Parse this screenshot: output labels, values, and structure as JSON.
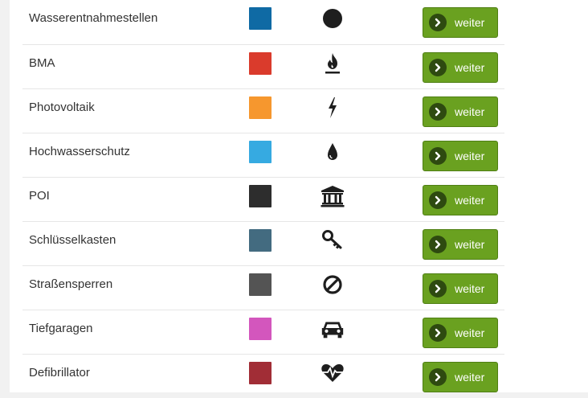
{
  "button_label": "weiter",
  "colors": {
    "button_bg": "#6aa120",
    "button_chevron_bg": "#2e4a10",
    "icon_color": "#1e1e1e"
  },
  "items": [
    {
      "label": "Wasserentnahmestellen",
      "color": "#0f6aa4",
      "icon": "circle-icon"
    },
    {
      "label": "BMA",
      "color": "#da3b2c",
      "icon": "fire-icon"
    },
    {
      "label": "Photovoltaik",
      "color": "#f6972e",
      "icon": "bolt-icon"
    },
    {
      "label": "Hochwasserschutz",
      "color": "#36aae1",
      "icon": "water-drop-icon"
    },
    {
      "label": "POI",
      "color": "#2d2d2d",
      "icon": "bank-icon"
    },
    {
      "label": "Schlüsselkasten",
      "color": "#436b80",
      "icon": "key-icon"
    },
    {
      "label": "Straßensperren",
      "color": "#545454",
      "icon": "ban-icon"
    },
    {
      "label": "Tiefgaragen",
      "color": "#d356bd",
      "icon": "car-icon"
    },
    {
      "label": "Defibrillator",
      "color": "#a12d36",
      "icon": "heartbeat-icon"
    }
  ]
}
